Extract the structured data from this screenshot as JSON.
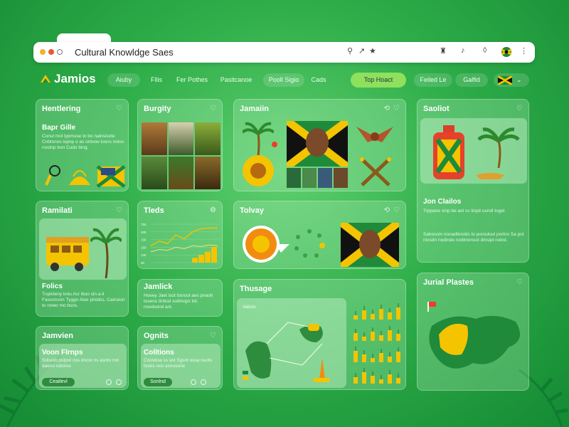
{
  "browser": {
    "url": "Cultural Knowldge Saes"
  },
  "brand": {
    "name": "Jamios"
  },
  "nav": {
    "items": [
      "Aiuby",
      "Fllis",
      "Fer Pothes",
      "Pasitcanoe",
      "Pooll Sigio",
      "Cads"
    ],
    "cta": "Top Hoact",
    "right_items": [
      "Feiled Le",
      "Galfid"
    ]
  },
  "cards": {
    "heritage": {
      "title": "Hentlering",
      "subtitle": "Bapr Gille",
      "body": "Conul mol lypmuse to bo nalnsisote Cnbtsnos lopnp o  as ortnow tosns nolos noolnp bon Cudo bing."
    },
    "beauty": {
      "title": "Burgity"
    },
    "jamaican": {
      "title": "Jamaiin"
    },
    "sawbot": {
      "title": "Saoliot",
      "subtitle": "Jon Clailos",
      "body1": "Trppane sinp be ast ss tinpit usndl togel.",
      "body2": "Sabsnoin nonadtinoids to poniulout portns Sa pnl niosdn nodinde noitinionsot dinsipt nokst."
    },
    "ramilati": {
      "title": "Ramilati",
      "subtitle": "Folics",
      "body": "Tnpinleny kniu Acr lkoo sin a-li Fasconsnn Tyggn Aiee pinidss. Cainsion to nowo mo bsos."
    },
    "tieds": {
      "title": "Tleds"
    },
    "tolvay": {
      "title": "Tolvay"
    },
    "jamlick": {
      "title": "Jamlick",
      "body": "Hoeey Jaet isot tisnsot aes pnaolt tosens tintiod sotilnops tot. ncedsend anl."
    },
    "jamvien": {
      "title": "Jamvien",
      "subtitle": "Voon Flrnps",
      "body": "Sdcesb pstpot oss dnost ns asnto nnt oaeno ndonss",
      "chip": "Ceatlevl"
    },
    "ognits": {
      "title": "Ognits",
      "subtitle": "Colltions",
      "body": "Coostioa ss sot Sgsnt ossa nuots tosirs non asnosone",
      "chip": "Sonlnd"
    },
    "thusage": {
      "title": "Thusage",
      "map_label": "Valicbs"
    },
    "jurial": {
      "title": "Jurial Plastes"
    }
  },
  "mini_chart": {
    "type": "line",
    "series": [
      {
        "name": "",
        "values": [
          22,
          28,
          25,
          36,
          31,
          40,
          44,
          45,
          45
        ]
      },
      {
        "name": "",
        "values": [
          14,
          17,
          16,
          20,
          18,
          22,
          21,
          23,
          22
        ]
      }
    ],
    "bars": [
      6,
      10,
      14,
      20
    ],
    "yticks": [
      "750",
      "200",
      "150",
      "150",
      "130",
      "50"
    ],
    "colors": {
      "line1": "#f2c200",
      "line2": "#f7e07a",
      "bars": "#f4c400"
    }
  },
  "colors": {
    "accent": "#8fe05c",
    "flag_yellow": "#f4c400",
    "flag_green": "#1e8a3a",
    "flag_black": "#111111"
  }
}
